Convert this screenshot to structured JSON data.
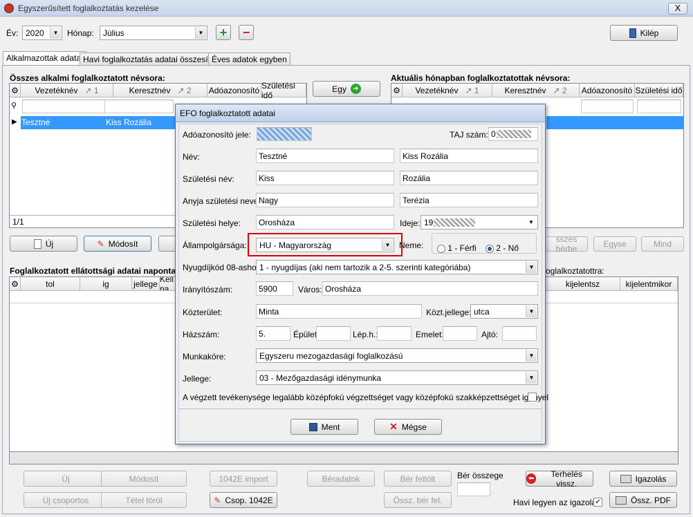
{
  "window": {
    "title": "Egyszerűsített foglalkoztatás kezelése",
    "close": "X"
  },
  "toolbar": {
    "year_label": "Év:",
    "year_value": "2020",
    "month_label": "Hónap:",
    "month_value": "Július",
    "add_symbol": "+",
    "remove_symbol": "−",
    "exit_label": "Kilép"
  },
  "tabs": [
    "Alkalmazottak adatai",
    "Havi foglalkoztatás adatai összesítve",
    "Éves adatok egyben"
  ],
  "left_list": {
    "title": "Összes alkalmi foglalkoztatott névsora:",
    "columns": [
      "Vezetéknév",
      "Keresztnév",
      "Adóazonosító",
      "Születési idő"
    ],
    "sort1": "↗ 1",
    "sort2": "↗ 2",
    "row": {
      "last": "Tesztné",
      "first": "Kiss Rozália"
    },
    "pager": "1/1"
  },
  "mid_buttons": {
    "egy": "Egy"
  },
  "right_list": {
    "title": "Aktuális hónapban foglalkoztatottak névsora:",
    "columns": [
      "Vezetéknév",
      "Keresztnév",
      "Adóazonosító",
      "Születési idő"
    ],
    "sort1": "↗ 1",
    "sort2": "↗ 2",
    "subtitle": "oglalkoztatottra:",
    "cols2": [
      "kijelentsz",
      "kijelentmikor"
    ]
  },
  "left_buttons": {
    "new": "Új",
    "modify": "Módosít"
  },
  "right_buttons": {
    "hire": "sszes bérbe",
    "egyse": "Egyse",
    "mind": "Mind"
  },
  "daily": {
    "title": "Foglalkoztatott ellátottsági adatai naponta",
    "columns": [
      "tol",
      "ig",
      "jellege",
      "Kell na"
    ]
  },
  "bottom": {
    "new": "Új",
    "modify": "Módosít",
    "import": "1042E import",
    "ber_data": "Béradatok",
    "ber_upload": "Bér feltölt",
    "ber_sum_label": "Bér összege",
    "load": "Terhelés vissz.",
    "cert": "Igazolás",
    "new_group": "Új csoportos",
    "delete_item": "Tétel töröl",
    "group_1042": "Csop. 1042E",
    "sum_ber": "Össz. bér fel.",
    "monthly_cert": "Havi legyen az igazolás",
    "sum_pdf": "Össz. PDF"
  },
  "dialog": {
    "title": "EFO foglalkoztatott adatai",
    "tax_label": "Adóazonosító jele:",
    "taj_label": "TAJ szám:",
    "taj_prefix": "0",
    "name_label": "Név:",
    "name_last": "Tesztné",
    "name_first": "Kiss Rozália",
    "birth_name_label": "Születési név:",
    "birth_last": "Kiss",
    "birth_first": "Rozália",
    "mother_label": "Anyja születési neve:",
    "mother_last": "Nagy",
    "mother_first": "Terézia",
    "birthplace_label": "Születési helye:",
    "birthplace": "Orosháza",
    "date_label": "Ideje:",
    "date_prefix": "19",
    "citizenship_label": "Állampolgársága:",
    "citizenship": "HU - Magyarország",
    "sex_label": "Neme:",
    "male": "1 - Férfi",
    "female": "2 - Nő",
    "pension_label": "Nyugdíjkód 08-ashoz:",
    "pension": "1 - nyugdíjas (aki nem tartozik a 2-5. szerinti kategóriába)",
    "zip_label": "Irányítószám:",
    "zip": "5900",
    "city_label": "Város:",
    "city": "Orosháza",
    "street_label": "Közterület:",
    "street": "Minta",
    "street_type_label": "Közt.jellege:",
    "street_type": "utca",
    "house_label": "Házszám:",
    "house": "5.",
    "building_label": "Épület:",
    "stair_label": "Lép.h.:",
    "floor_label": "Emelet:",
    "door_label": "Ajtó:",
    "job_label": "Munkaköre:",
    "job": "Egyszeru mezogazdasági foglalkozású",
    "type_label": "Jellege:",
    "type": "03 - Mezőgazdasági idénymunka",
    "education_text": "A végzett tevékenysége legalább középfokú végzettséget vagy középfokú szakképzettséget igényel",
    "save": "Ment",
    "cancel": "Mégse"
  }
}
